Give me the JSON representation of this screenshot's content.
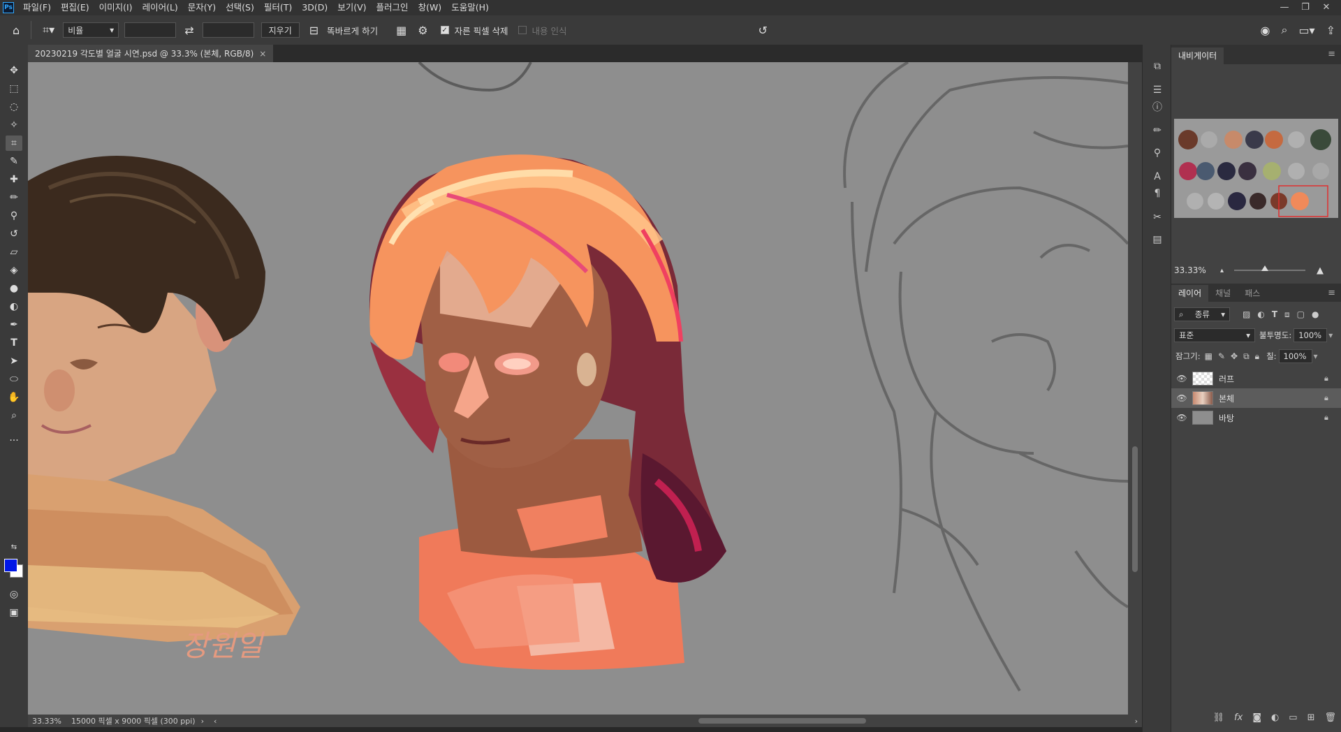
{
  "app": {
    "logo": "Ps"
  },
  "menu": [
    "파일(F)",
    "편집(E)",
    "이미지(I)",
    "레이어(L)",
    "문자(Y)",
    "선택(S)",
    "필터(T)",
    "3D(D)",
    "보기(V)",
    "플러그인",
    "창(W)",
    "도움말(H)"
  ],
  "window_controls": {
    "minimize": "—",
    "restore": "❐",
    "close": "✕"
  },
  "options": {
    "ratio_select": "비율",
    "swap_icon": "⇄",
    "clear_button": "지우기",
    "straighten_label": "똑바르게 하기",
    "delete_cropped_label": "자른 픽셀 삭제",
    "delete_cropped_checked": true,
    "content_aware_label": "내용 인식",
    "content_aware_checked": false
  },
  "document": {
    "tab_title": "20230219 각도별 얼굴 시연.psd @ 33.3% (본체, RGB/8)",
    "zoom": "33.33%",
    "info": "15000 픽셀 x 9000 픽셀 (300 ppi)",
    "signature_text": "장원일"
  },
  "navigator": {
    "tab": "내비게이터",
    "zoom": "33.33%"
  },
  "layers_panel": {
    "tabs": [
      "레이어",
      "채널",
      "패스"
    ],
    "filter": "종류",
    "blend_mode": "표준",
    "opacity_label": "불투명도:",
    "opacity": "100%",
    "lock_label": "잠그기:",
    "fill_label": "칠:",
    "fill": "100%",
    "layers": [
      {
        "name": "러프",
        "selected": false,
        "thumb": "transparent"
      },
      {
        "name": "본체",
        "selected": true,
        "thumb": "art"
      },
      {
        "name": "바탕",
        "selected": false,
        "thumb": "gray"
      }
    ]
  },
  "colors": {
    "foreground": "#0017e6",
    "background": "#ffffff",
    "canvas": "#8e8e8e"
  }
}
